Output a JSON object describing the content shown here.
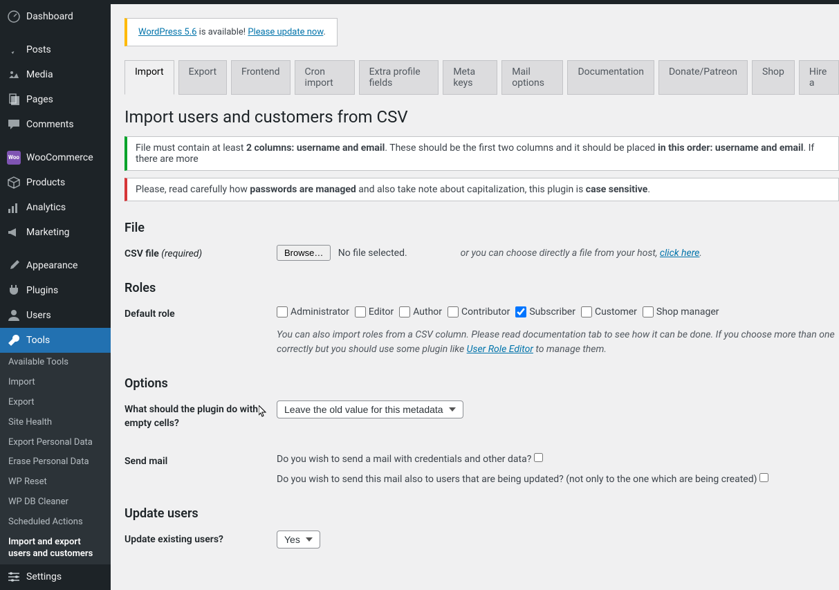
{
  "sidebar": {
    "items": [
      {
        "label": "Dashboard",
        "icon": "dashboard"
      },
      {
        "label": "Posts",
        "icon": "pin"
      },
      {
        "label": "Media",
        "icon": "media"
      },
      {
        "label": "Pages",
        "icon": "page"
      },
      {
        "label": "Comments",
        "icon": "comment"
      },
      {
        "label": "WooCommerce",
        "icon": "woo"
      },
      {
        "label": "Products",
        "icon": "archive"
      },
      {
        "label": "Analytics",
        "icon": "chart"
      },
      {
        "label": "Marketing",
        "icon": "megaphone"
      },
      {
        "label": "Appearance",
        "icon": "brush"
      },
      {
        "label": "Plugins",
        "icon": "plugin"
      },
      {
        "label": "Users",
        "icon": "users"
      },
      {
        "label": "Tools",
        "icon": "tools"
      },
      {
        "label": "Settings",
        "icon": "settings"
      }
    ],
    "submenu": {
      "items": [
        {
          "label": "Available Tools"
        },
        {
          "label": "Import"
        },
        {
          "label": "Export"
        },
        {
          "label": "Site Health"
        },
        {
          "label": "Export Personal Data"
        },
        {
          "label": "Erase Personal Data"
        },
        {
          "label": "WP Reset"
        },
        {
          "label": "WP DB Cleaner"
        },
        {
          "label": "Scheduled Actions"
        },
        {
          "label": "Import and export users and customers"
        }
      ]
    }
  },
  "notice": {
    "prefix": "WordPress 5.6",
    "mid": " is available! ",
    "link": "Please update now"
  },
  "tabs": [
    "Import",
    "Export",
    "Frontend",
    "Cron import",
    "Extra profile fields",
    "Meta keys",
    "Mail options",
    "Documentation",
    "Donate/Patreon",
    "Shop",
    "Hire a"
  ],
  "page_title": "Import users and customers from CSV",
  "msg1": {
    "a": "File must contain at least ",
    "b": "2 columns: username and email",
    "c": ". These should be the first two columns and it should be placed ",
    "d": "in this order: username and email",
    "e": ". If there are more"
  },
  "msg2": {
    "a": "Please, read carefully how ",
    "b": "passwords are managed",
    "c": " and also take note about capitalization, this plugin is ",
    "d": "case sensitive",
    "e": "."
  },
  "file": {
    "heading": "File",
    "label": "CSV file ",
    "required": "(required)",
    "browse": "Browse…",
    "no_file": "No file selected.",
    "or": "or you can choose directly a file from your host, ",
    "click": "click here"
  },
  "roles": {
    "heading": "Roles",
    "label": "Default role",
    "options": [
      {
        "name": "Administrator",
        "checked": false
      },
      {
        "name": "Editor",
        "checked": false
      },
      {
        "name": "Author",
        "checked": false
      },
      {
        "name": "Contributor",
        "checked": false
      },
      {
        "name": "Subscriber",
        "checked": true
      },
      {
        "name": "Customer",
        "checked": false
      },
      {
        "name": "Shop manager",
        "checked": false
      }
    ],
    "help_a": "You can also import roles from a CSV column. Please read documentation tab to see how it can be done. If you choose more than one correctly but you should use some plugin like ",
    "help_link": "User Role Editor",
    "help_b": " to manage them."
  },
  "options": {
    "heading": "Options",
    "empty_label": "What should the plugin do with empty cells?",
    "empty_select": "Leave the old value for this metadata",
    "sendmail_label": "Send mail",
    "sendmail_q1": "Do you wish to send a mail with credentials and other data?",
    "sendmail_q2": "Do you wish to send this mail also to users that are being updated? (not only to the one which are being created)"
  },
  "update": {
    "heading": "Update users",
    "label": "Update existing users?",
    "select": "Yes"
  }
}
